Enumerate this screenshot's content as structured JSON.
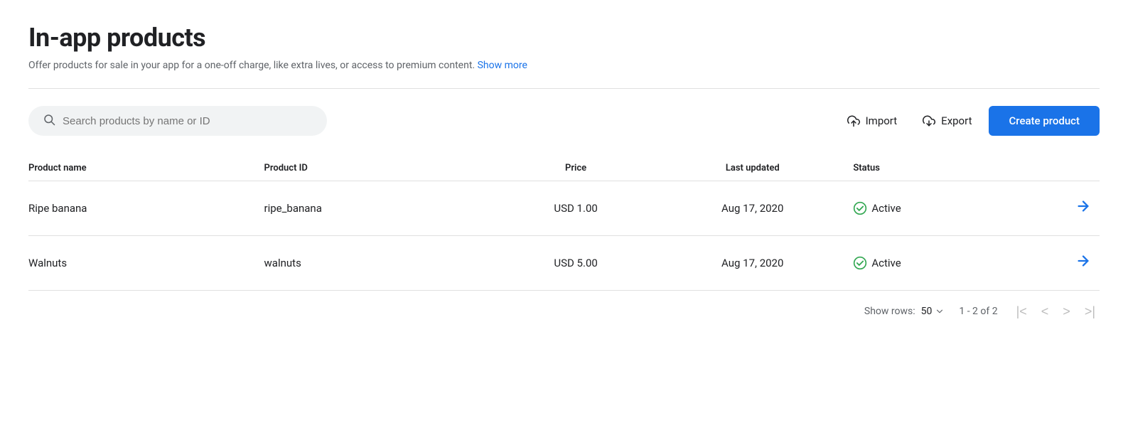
{
  "page": {
    "title": "In-app products",
    "subtitle": "Offer products for sale in your app for a one-off charge, like extra lives, or access to premium content.",
    "show_more_label": "Show more"
  },
  "toolbar": {
    "search_placeholder": "Search products by name or ID",
    "import_label": "Import",
    "export_label": "Export",
    "create_label": "Create product"
  },
  "table": {
    "columns": [
      {
        "key": "product_name",
        "label": "Product name"
      },
      {
        "key": "product_id",
        "label": "Product ID"
      },
      {
        "key": "price",
        "label": "Price"
      },
      {
        "key": "last_updated",
        "label": "Last updated"
      },
      {
        "key": "status",
        "label": "Status"
      }
    ],
    "rows": [
      {
        "product_name": "Ripe banana",
        "product_id": "ripe_banana",
        "price": "USD 1.00",
        "last_updated": "Aug 17, 2020",
        "status": "Active"
      },
      {
        "product_name": "Walnuts",
        "product_id": "walnuts",
        "price": "USD 5.00",
        "last_updated": "Aug 17, 2020",
        "status": "Active"
      }
    ]
  },
  "pagination": {
    "show_rows_label": "Show rows:",
    "rows_per_page": "50",
    "page_info": "1 - 2 of 2"
  },
  "colors": {
    "active_check": "#34a853",
    "arrow": "#1a73e8",
    "create_btn_bg": "#1a73e8"
  }
}
